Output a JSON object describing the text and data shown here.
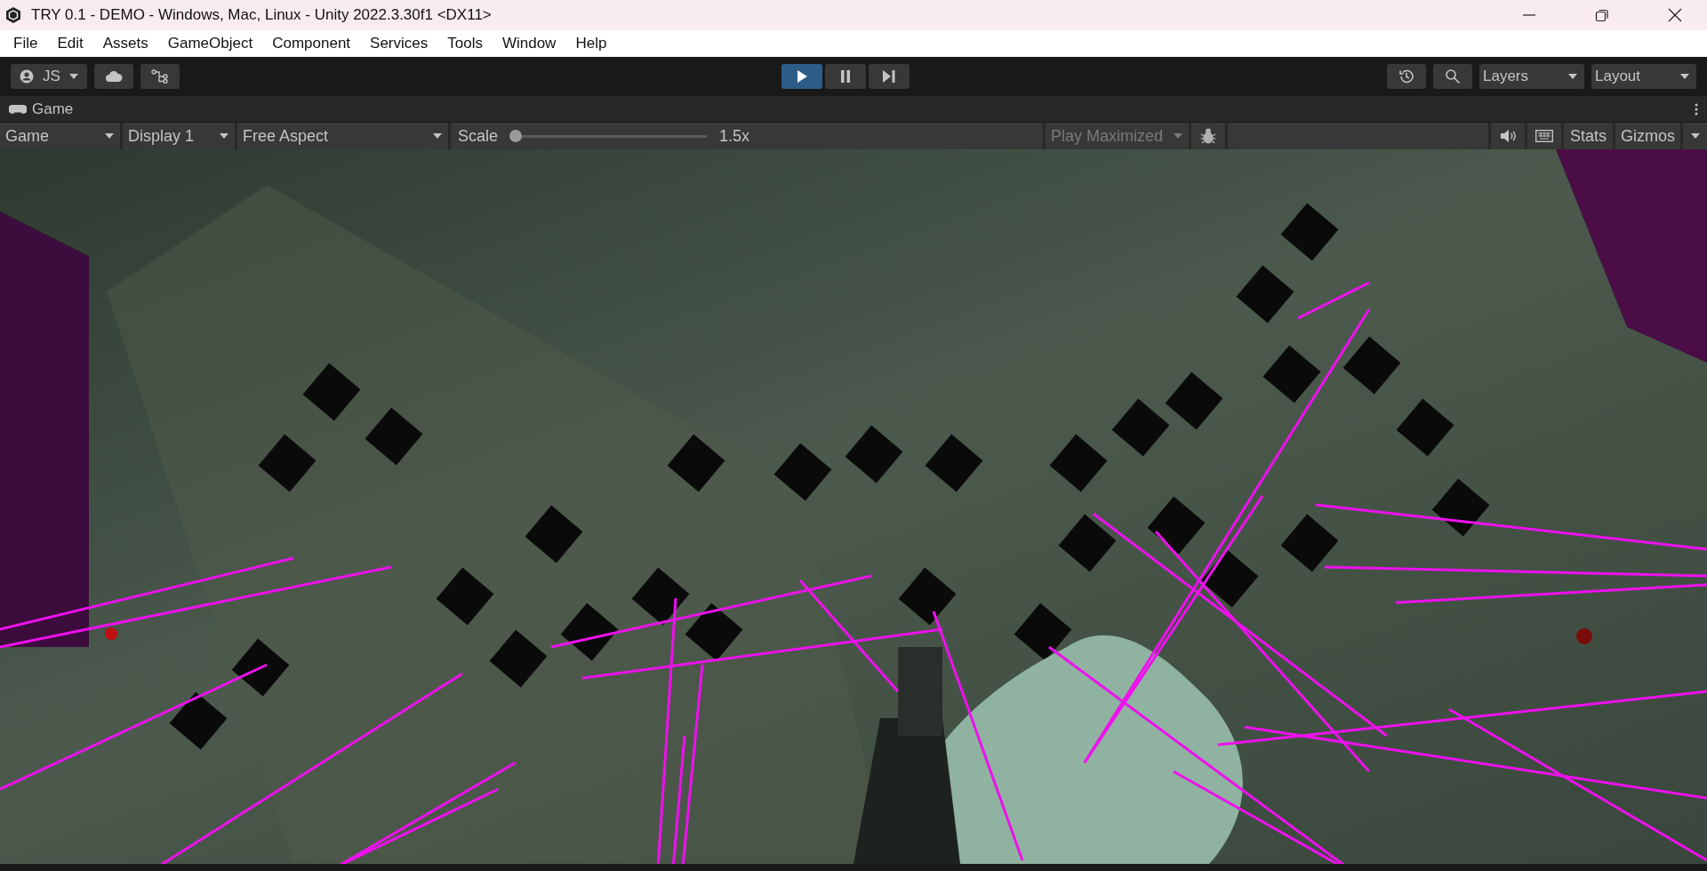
{
  "window": {
    "title": "TRY 0.1 - DEMO - Windows, Mac, Linux - Unity 2022.3.30f1 <DX11>"
  },
  "menu": [
    "File",
    "Edit",
    "Assets",
    "GameObject",
    "Component",
    "Services",
    "Tools",
    "Window",
    "Help"
  ],
  "toolbar": {
    "account": "JS",
    "play_controls": [
      {
        "kind": "play",
        "on": true
      },
      {
        "kind": "pause",
        "on": false
      },
      {
        "kind": "step",
        "on": false
      }
    ],
    "layers": "Layers",
    "layout": "Layout"
  },
  "game_tab": {
    "title": "Game"
  },
  "game_toolbar": {
    "view": "Game",
    "display": "Display 1",
    "aspect": "Free Aspect",
    "scale_label": "Scale",
    "scale": {
      "level": 0
    },
    "scale_reading": "1.5x",
    "play_maximized": {
      "label": "Play Maximized",
      "disabled": true
    },
    "stats": "Stats",
    "gizmos": "Gizmos"
  }
}
